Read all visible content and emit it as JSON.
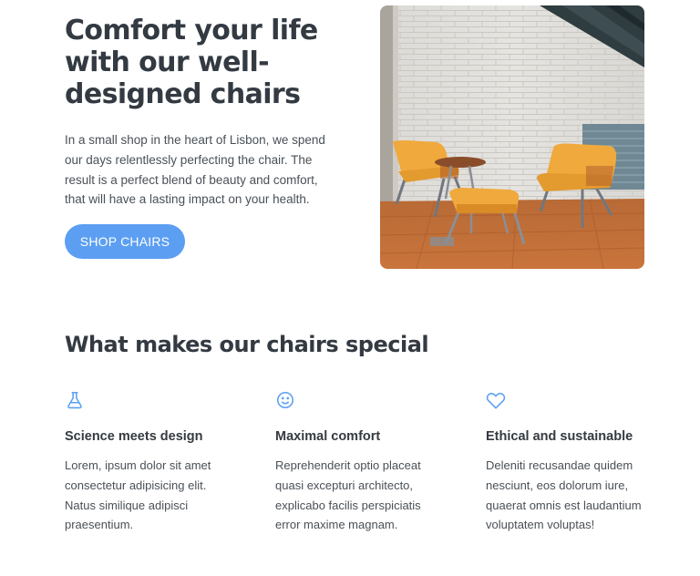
{
  "hero": {
    "title": "Comfort your life with our well-designed chairs",
    "text": "In a small shop in the heart of Lisbon, we spend our days relentlessly perfecting the chair. The result is a perfect blend of beauty and comfort, that will have a lasting impact on your health.",
    "button_label": "SHOP CHAIRS",
    "image_alt": "Two orange lounge chairs, a round side table and an ottoman in front of a white brick wall"
  },
  "features": {
    "title": "What makes our chairs special",
    "items": [
      {
        "icon": "flask-icon",
        "title": "Science meets design",
        "text": "Lorem, ipsum dolor sit amet consectetur adipisicing elit. Natus similique adipisci praesentium."
      },
      {
        "icon": "smiley-icon",
        "title": "Maximal comfort",
        "text": "Reprehenderit optio placeat quasi excepturi architecto, explicabo facilis perspiciatis error maxime magnam."
      },
      {
        "icon": "heart-icon",
        "title": "Ethical and sustainable",
        "text": "Deleniti recusandae quidem nesciunt, eos dolorum iure, quaerat omnis est laudantium voluptatem voluptas!"
      }
    ]
  },
  "colors": {
    "accent": "#5c9ff2",
    "heading": "#333a42",
    "body_text": "#495057",
    "chair_orange": "#f0a93c"
  }
}
